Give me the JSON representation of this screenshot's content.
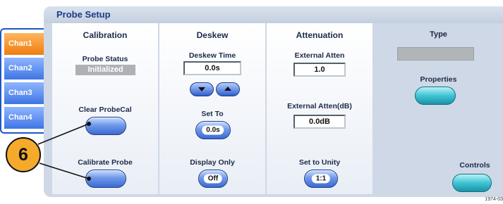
{
  "window": {
    "title": "Probe Setup"
  },
  "tabs": [
    {
      "label": "Chan1",
      "active": true
    },
    {
      "label": "Chan2",
      "active": false
    },
    {
      "label": "Chan3",
      "active": false
    },
    {
      "label": "Chan4",
      "active": false
    }
  ],
  "calibration": {
    "heading": "Calibration",
    "probe_status_label": "Probe Status",
    "probe_status_value": "Initialized",
    "clear_probecal_label": "Clear ProbeCal",
    "calibrate_probe_label": "Calibrate Probe"
  },
  "deskew": {
    "heading": "Deskew",
    "deskew_time_label": "Deskew Time",
    "deskew_time_value": "0.0s",
    "set_to_label": "Set To",
    "set_to_value": "0.0s",
    "display_only_label": "Display Only",
    "display_only_value": "Off"
  },
  "attenuation": {
    "heading": "Attenuation",
    "external_atten_label": "External Atten",
    "external_atten_value": "1.0",
    "external_atten_db_label": "External Atten(dB)",
    "external_atten_db_value": "0.0dB",
    "set_to_unity_label": "Set to Unity",
    "set_to_unity_value": "1:1"
  },
  "type": {
    "heading": "Type",
    "properties_label": "Properties",
    "controls_label": "Controls"
  },
  "callout": {
    "number": "6"
  },
  "figure_number": "1974-03",
  "colors": {
    "title_text": "#1b3a86",
    "tab_active": "#f07c10",
    "tab_normal": "#3f75e4",
    "button_blue": "#3d6ad0",
    "button_teal": "#3fc4d4",
    "callout": "#f6aa2c"
  },
  "icons": {
    "deskew_down": "triangle-down-icon",
    "deskew_up": "triangle-up-icon"
  }
}
